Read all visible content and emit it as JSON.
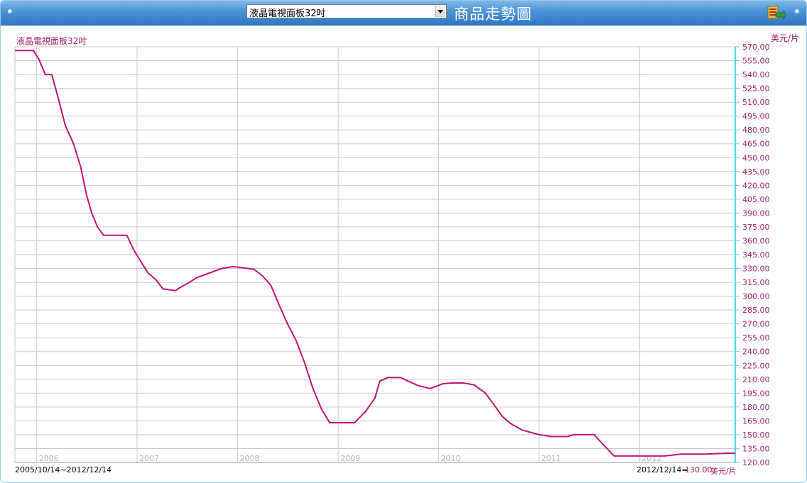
{
  "header": {
    "product_select_value": "液晶電視面板32吋",
    "page_title": "商品走勢圖",
    "export_icon": "excel-export-icon"
  },
  "colors": {
    "line": "#c0127a",
    "label_text": "#a0206a",
    "y_axis": "#4fd8e0",
    "grid": "#c8c8c8",
    "header_bg": "#3b86cf"
  },
  "footer": {
    "date_range": "2005/10/14~2012/12/14",
    "latest_date": "2012/12/14=",
    "latest_value": "130.00",
    "latest_unit": "美元/片"
  },
  "chart_data": {
    "type": "line",
    "title": "液晶電視面板32吋",
    "ylabel": "美元/片",
    "y_axis_position": "right",
    "xlim": [
      "2005-10-14",
      "2012-12-14"
    ],
    "ylim": [
      120,
      570
    ],
    "y_ticks": [
      "570.00",
      "555.00",
      "540.00",
      "525.00",
      "510.00",
      "495.00",
      "480.00",
      "465.00",
      "450.00",
      "435.00",
      "420.00",
      "405.00",
      "390.00",
      "375.00",
      "360.00",
      "345.00",
      "330.00",
      "315.00",
      "300.00",
      "285.00",
      "270.00",
      "255.00",
      "240.00",
      "225.00",
      "210.00",
      "195.00",
      "180.00",
      "165.00",
      "150.00",
      "135.00",
      "120.00"
    ],
    "x_ticks": [
      {
        "label": "2006",
        "date": "2006-01-01"
      },
      {
        "label": "2007",
        "date": "2007-01-01"
      },
      {
        "label": "2008",
        "date": "2008-01-01"
      },
      {
        "label": "2009",
        "date": "2009-01-01"
      },
      {
        "label": "2010",
        "date": "2010-01-01"
      },
      {
        "label": "2011",
        "date": "2011-01-01"
      },
      {
        "label": "2012",
        "date": "2012-01-01"
      }
    ],
    "grid": true,
    "series": [
      {
        "points": [
          [
            "2005-10-14",
            566
          ],
          [
            "2005-12-20",
            566
          ],
          [
            "2006-01-10",
            556
          ],
          [
            "2006-02-01",
            540
          ],
          [
            "2006-02-25",
            540
          ],
          [
            "2006-03-20",
            515
          ],
          [
            "2006-04-15",
            485
          ],
          [
            "2006-05-15",
            465
          ],
          [
            "2006-06-10",
            440
          ],
          [
            "2006-07-01",
            410
          ],
          [
            "2006-07-20",
            390
          ],
          [
            "2006-08-10",
            375
          ],
          [
            "2006-09-01",
            366
          ],
          [
            "2006-11-25",
            366
          ],
          [
            "2006-12-20",
            350
          ],
          [
            "2007-01-20",
            335
          ],
          [
            "2007-02-10",
            325
          ],
          [
            "2007-03-10",
            318
          ],
          [
            "2007-04-05",
            308
          ],
          [
            "2007-05-20",
            306
          ],
          [
            "2007-06-10",
            310
          ],
          [
            "2007-07-10",
            315
          ],
          [
            "2007-08-05",
            320
          ],
          [
            "2007-09-20",
            325
          ],
          [
            "2007-11-05",
            330
          ],
          [
            "2007-12-15",
            332
          ],
          [
            "2008-01-15",
            331
          ],
          [
            "2008-03-01",
            329
          ],
          [
            "2008-04-01",
            322
          ],
          [
            "2008-05-01",
            312
          ],
          [
            "2008-06-01",
            290
          ],
          [
            "2008-07-01",
            270
          ],
          [
            "2008-08-01",
            252
          ],
          [
            "2008-09-01",
            228
          ],
          [
            "2008-10-01",
            200
          ],
          [
            "2008-11-01",
            178
          ],
          [
            "2008-12-01",
            163
          ],
          [
            "2009-03-01",
            163
          ],
          [
            "2009-04-10",
            175
          ],
          [
            "2009-05-15",
            190
          ],
          [
            "2009-06-01",
            208
          ],
          [
            "2009-07-01",
            212
          ],
          [
            "2009-08-15",
            212
          ],
          [
            "2009-09-20",
            207
          ],
          [
            "2009-10-20",
            203
          ],
          [
            "2009-12-01",
            200
          ],
          [
            "2010-01-15",
            205
          ],
          [
            "2010-02-15",
            206
          ],
          [
            "2010-04-01",
            206
          ],
          [
            "2010-05-10",
            204
          ],
          [
            "2010-06-20",
            195
          ],
          [
            "2010-07-20",
            183
          ],
          [
            "2010-08-20",
            170
          ],
          [
            "2010-09-20",
            162
          ],
          [
            "2010-11-01",
            155
          ],
          [
            "2011-01-01",
            150
          ],
          [
            "2011-02-15",
            148
          ],
          [
            "2011-04-15",
            148
          ],
          [
            "2011-05-05",
            150
          ],
          [
            "2011-07-20",
            150
          ],
          [
            "2011-08-20",
            140
          ],
          [
            "2011-10-01",
            127
          ],
          [
            "2012-01-01",
            127
          ],
          [
            "2012-04-01",
            127
          ],
          [
            "2012-06-01",
            129
          ],
          [
            "2012-09-01",
            129
          ],
          [
            "2012-11-15",
            130
          ],
          [
            "2012-12-14",
            130
          ]
        ]
      }
    ]
  }
}
